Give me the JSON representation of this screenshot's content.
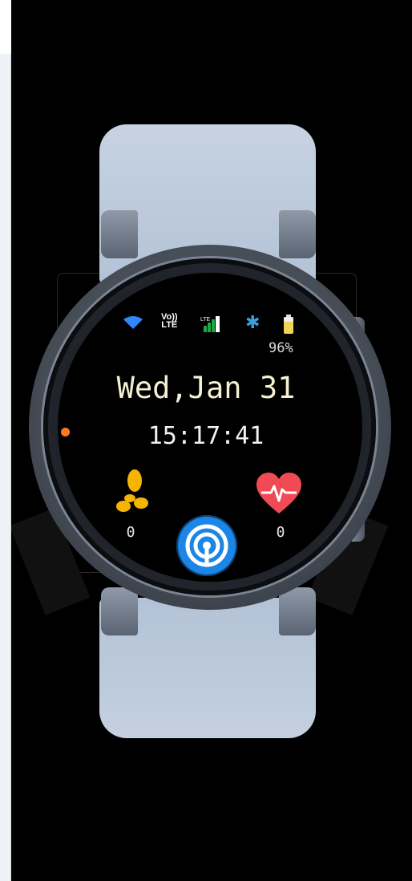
{
  "watch_face": {
    "status": {
      "wifi_icon": "wifi-icon",
      "volte_top": "Vo))",
      "volte_bottom": "LTE",
      "lte_label": "LTE",
      "bluetooth_glyph": "✱",
      "battery_percent": "96%"
    },
    "date": "Wed,Jan 31",
    "time": "15:17:41",
    "steps": {
      "icon": "footsteps-icon",
      "value": "0"
    },
    "heart_rate": {
      "icon": "heart-rate-icon",
      "value": "0"
    },
    "center_button_icon": "signal-broadcast-icon",
    "colors": {
      "date_text": "#f4f0d2",
      "accent_orange": "#ff7a1f",
      "steps_yellow": "#f5b400",
      "heart_red": "#f04a55",
      "button_blue": "#1c86e6",
      "bluetooth_blue": "#3aa0e0"
    }
  }
}
